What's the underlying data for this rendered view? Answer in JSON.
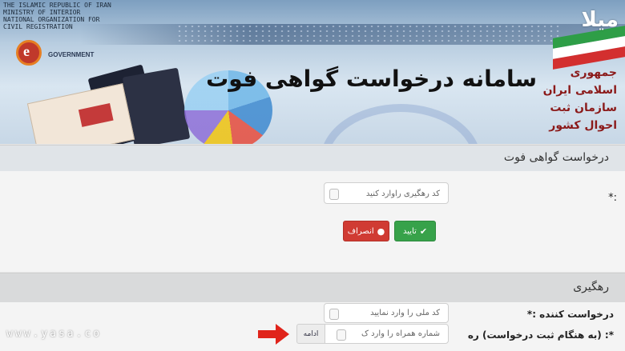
{
  "header": {
    "ministry_lines": "THE ISLAMIC REPUBLIC OF IRAN\nMINISTRY OF INTERIOR\nNATIONAL ORGANIZATION FOR\nCIVIL REGISTRATION",
    "egov_letter": "e",
    "egov_text": "GOVERNMENT",
    "title": "سامانه درخواست گواهی فوت",
    "org_name": "جمهوری اسلامی ایران سازمان ثبت احوال کشور",
    "watermark": "میلا"
  },
  "request_section": {
    "title": "درخواست گواهی فوت",
    "field_label": "*:",
    "tracking_placeholder": "کد رهگیری راوارد کنید",
    "confirm_label": "تایید",
    "cancel_label": "انصراف",
    "confirm_glyph": "✔",
    "cancel_glyph": "●"
  },
  "tracking_section": {
    "title": "رهگیری",
    "applicant_label": "درخواست کننده :*",
    "national_code_placeholder": "کد ملی را وارد نمایید",
    "phone_label": "*: (به هنگام ثبت درخواست) ره",
    "phone_placeholder": "شماره همراه را وارد ک",
    "continue_label": "ادامه"
  },
  "footer": {
    "site": "www.yasa.co"
  },
  "colors": {
    "confirm": "#37a24a",
    "cancel": "#d03b33",
    "arrow": "#e0241b"
  }
}
